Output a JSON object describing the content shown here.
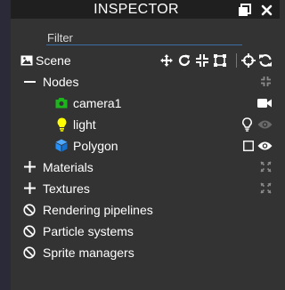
{
  "header": {
    "title": "INSPECTOR"
  },
  "filter": {
    "placeholder": "Filter"
  },
  "scene": {
    "label": "Scene"
  },
  "nodes": {
    "label": "Nodes",
    "items": [
      {
        "label": "camera1",
        "icon": "camera-icon",
        "color": "#1db51d"
      },
      {
        "label": "light",
        "icon": "lightbulb-icon",
        "color": "#ffff00"
      },
      {
        "label": "Polygon",
        "icon": "cube-icon",
        "color": "#1e90ff"
      }
    ]
  },
  "sections": [
    {
      "label": "Materials",
      "icon": "plus-icon"
    },
    {
      "label": "Textures",
      "icon": "plus-icon"
    },
    {
      "label": "Rendering pipelines",
      "icon": "ban-icon"
    },
    {
      "label": "Particle systems",
      "icon": "ban-icon"
    },
    {
      "label": "Sprite managers",
      "icon": "ban-icon"
    }
  ]
}
